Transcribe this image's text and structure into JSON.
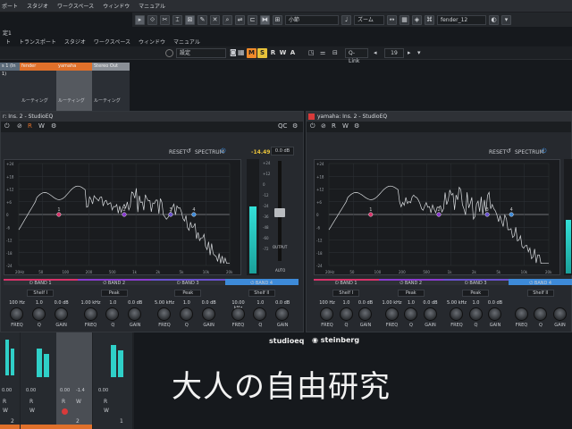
{
  "menu": [
    "ポート",
    "スタジオ",
    "ワークスペース",
    "ウィンドウ",
    "マニュアル"
  ],
  "toolbar": {
    "snap_label": "小節",
    "zoom_label": "ズーム",
    "track_label": "fender_12"
  },
  "project": {
    "title": "定1"
  },
  "menu2": [
    "ト",
    "トランスポート",
    "スタジオ",
    "ワークスペース",
    "ウィンドウ",
    "マニュアル"
  ],
  "mixer_toolbar": {
    "settings_label": "設定",
    "buttons": [
      "M",
      "S",
      "R",
      "W",
      "A"
    ],
    "qlink_label": "Q-Link",
    "channel_number": "19"
  },
  "channels": [
    {
      "name": "s 1 (In 1)",
      "color": "#5b6b7a"
    },
    {
      "name": "fender",
      "color": "#e0702a"
    },
    {
      "name": "yamaha",
      "color": "#e0702a"
    },
    {
      "name": "Stereo Out",
      "color": "#8a8f96"
    }
  ],
  "channel_routing": [
    "ルーティング",
    "ルーティング",
    "ルーティング"
  ],
  "windows": [
    {
      "title": "r: Ins. 2 - StudioEQ",
      "reset_label": "RESET",
      "spectrum_label": "SPECTRUM",
      "meter_peak": "-14.49",
      "output_db": "0.0 dB",
      "output_label": "OUTPUT",
      "auto_label": "AUTO",
      "freq_ticks": [
        "20Hz",
        "50",
        "100",
        "200",
        "500",
        "1k",
        "2k",
        "5k",
        "10k",
        "20k"
      ],
      "db_ticks": [
        "+24",
        "+18",
        "+12",
        "+6",
        "0",
        "-6",
        "-12",
        "-18",
        "-24"
      ],
      "meter_ticks": [
        "+24",
        "+12",
        "0",
        "-12",
        "-24",
        "-36",
        "-48",
        "-60",
        "-72"
      ],
      "bands": [
        {
          "label": "BAND 1",
          "type": "Shelf I",
          "freq": "100 Hz",
          "q": "1.0",
          "gain": "0.0 dB",
          "color": "#d8336a",
          "point": "1"
        },
        {
          "label": "BAND 2",
          "type": "Peak",
          "freq": "1.00 kHz",
          "q": "1.0",
          "gain": "0.0 dB",
          "color": "#8a3ccf",
          "point": "2"
        },
        {
          "label": "BAND 3",
          "type": "Peak",
          "freq": "5.00 kHz",
          "q": "1.0",
          "gain": "0.0 dB",
          "color": "#6a52cf",
          "point": "3"
        },
        {
          "label": "BAND 4",
          "type": "Shelf II",
          "freq": "10.00 kHz",
          "q": "1.0",
          "gain": "0.0 dB",
          "color": "#3d8ad8",
          "point": "4"
        }
      ],
      "knob_labels": [
        "FREQ",
        "Q",
        "GAIN"
      ],
      "brand": "steinberg",
      "product": "studioeq"
    },
    {
      "title": "yamaha: Ins. 2 - StudioEQ",
      "reset_label": "RESET",
      "spectrum_label": "SPECTRUM",
      "freq_ticks": [
        "20Hz",
        "50",
        "100",
        "200",
        "500",
        "1k",
        "2k",
        "5k",
        "10k",
        "20k"
      ],
      "db_ticks": [
        "+24",
        "+18",
        "+12",
        "+6",
        "0",
        "-6",
        "-12",
        "-18",
        "-24"
      ],
      "bands": [
        {
          "label": "BAND 1",
          "type": "Shelf I",
          "freq": "100 Hz",
          "q": "1.0",
          "gain": "0.0 dB",
          "color": "#d8336a",
          "point": "1"
        },
        {
          "label": "BAND 2",
          "type": "Peak",
          "freq": "1.00 kHz",
          "q": "1.0",
          "gain": "0.0 dB",
          "color": "#8a3ccf",
          "point": "2"
        },
        {
          "label": "BAND 3",
          "type": "Peak",
          "freq": "5.00 kHz",
          "q": "1.0",
          "gain": "0.0 dB",
          "color": "#6a52cf",
          "point": "3"
        },
        {
          "label": "BAND 4",
          "type": "Shelf II",
          "freq": "",
          "q": "",
          "gain": "",
          "color": "#3d8ad8",
          "point": "4"
        }
      ],
      "knob_labels": [
        "FREQ",
        "Q",
        "GAIN"
      ],
      "brand": "steinberg"
    }
  ],
  "bottom_mixer": {
    "values": [
      "0.00",
      "0.00",
      "-1.4",
      "0.00"
    ],
    "rw": [
      "R",
      "W"
    ],
    "numbers": [
      "2",
      "2",
      "1"
    ]
  },
  "caption": "大人の自由研究",
  "colors": {
    "accent_orange": "#e0702a",
    "meter_cyan": "#2fd0c8",
    "mute_orange": "#f08a2a",
    "solo_yellow": "#e8c23a",
    "record_red": "#d83a3a"
  }
}
